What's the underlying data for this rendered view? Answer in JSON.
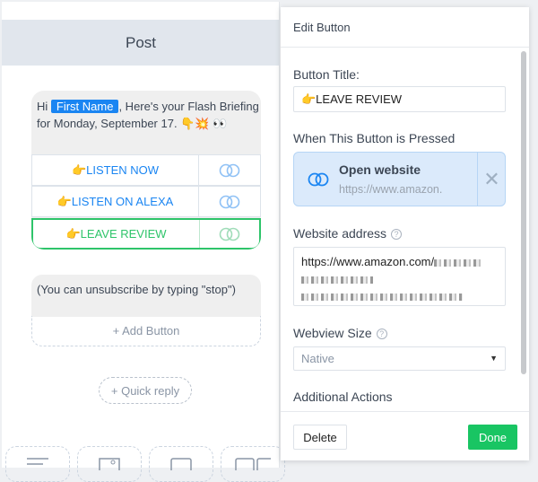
{
  "post": {
    "title": "Post",
    "message": {
      "prefix": "Hi ",
      "variable": "First Name",
      "suffix": ", Here's your Flash Briefing for Monday, September 17. 👇💥 👀"
    },
    "buttons": [
      {
        "label": "👉LISTEN NOW"
      },
      {
        "label": "👉LISTEN ON ALEXA"
      },
      {
        "label": "👉LEAVE REVIEW",
        "selected": true
      }
    ],
    "message2": "(You can unsubscribe by typing \"stop\")",
    "add_button": "+ Add Button",
    "quick_reply": "+ Quick reply"
  },
  "panel": {
    "title": "Edit Button",
    "button_title_label": "Button Title:",
    "button_title_value": "👉LEAVE REVIEW",
    "pressed_label": "When This Button is Pressed",
    "action": {
      "title": "Open website",
      "subtitle": "https://www.amazon."
    },
    "website_label": "Website address",
    "website_value": "https://www.amazon.com/",
    "webview_label": "Webview Size",
    "webview_value": "Native",
    "additional_label": "Additional Actions",
    "delete": "Delete",
    "done": "Done"
  },
  "colors": {
    "accent": "#1a85f2",
    "selected": "#2ec46a",
    "done": "#19c563"
  }
}
